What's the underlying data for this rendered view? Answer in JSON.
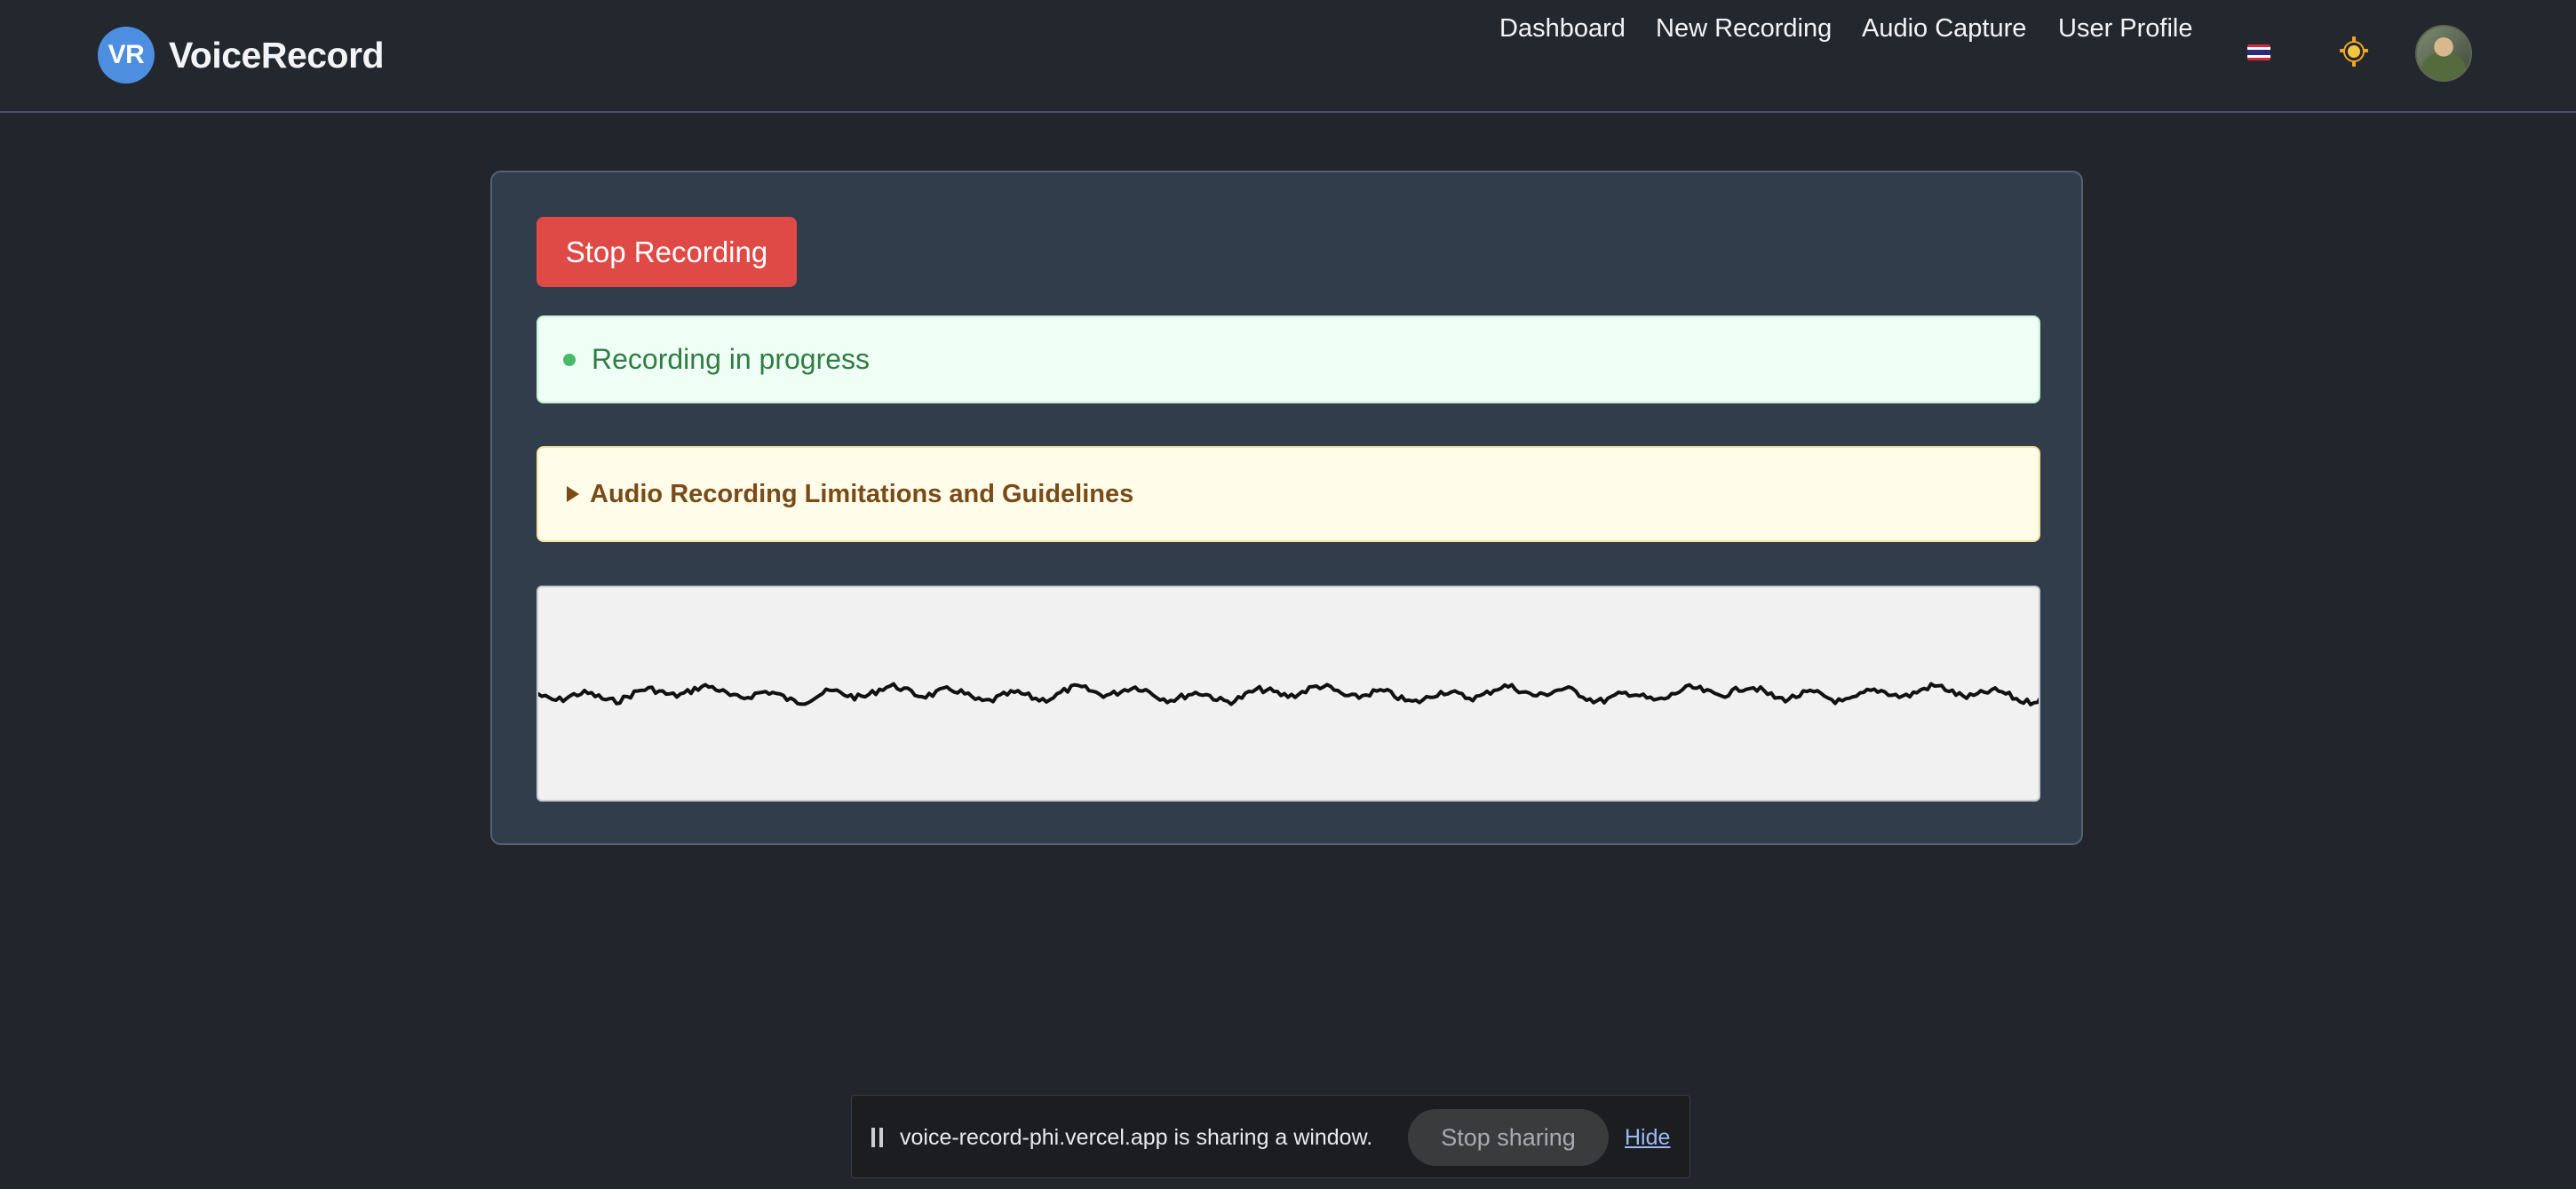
{
  "header": {
    "logo_badge": "VR",
    "app_name": "VoiceRecord",
    "nav": [
      {
        "label": "Dashboard"
      },
      {
        "label": "New Recording"
      },
      {
        "label": "Audio Capture"
      },
      {
        "label": "User Profile"
      }
    ],
    "language_icon": "thai-flag-icon",
    "theme_icon": "sun-icon",
    "avatar_icon": "user-avatar"
  },
  "recorder": {
    "stop_label": "Stop Recording",
    "status_text": "Recording in progress",
    "guidelines_label": "Audio Recording Limitations and Guidelines",
    "waveform_color": "#111111"
  },
  "share_bar": {
    "message": "voice-record-phi.vercel.app is sharing a window.",
    "stop_label": "Stop sharing",
    "hide_label": "Hide"
  },
  "colors": {
    "background": "#22262c",
    "card": "#323d4b",
    "stop_button": "#e04a46",
    "status_green": "#2f7d44",
    "guide_brown": "#7a4a18",
    "logo_blue": "#4d8ee0"
  }
}
